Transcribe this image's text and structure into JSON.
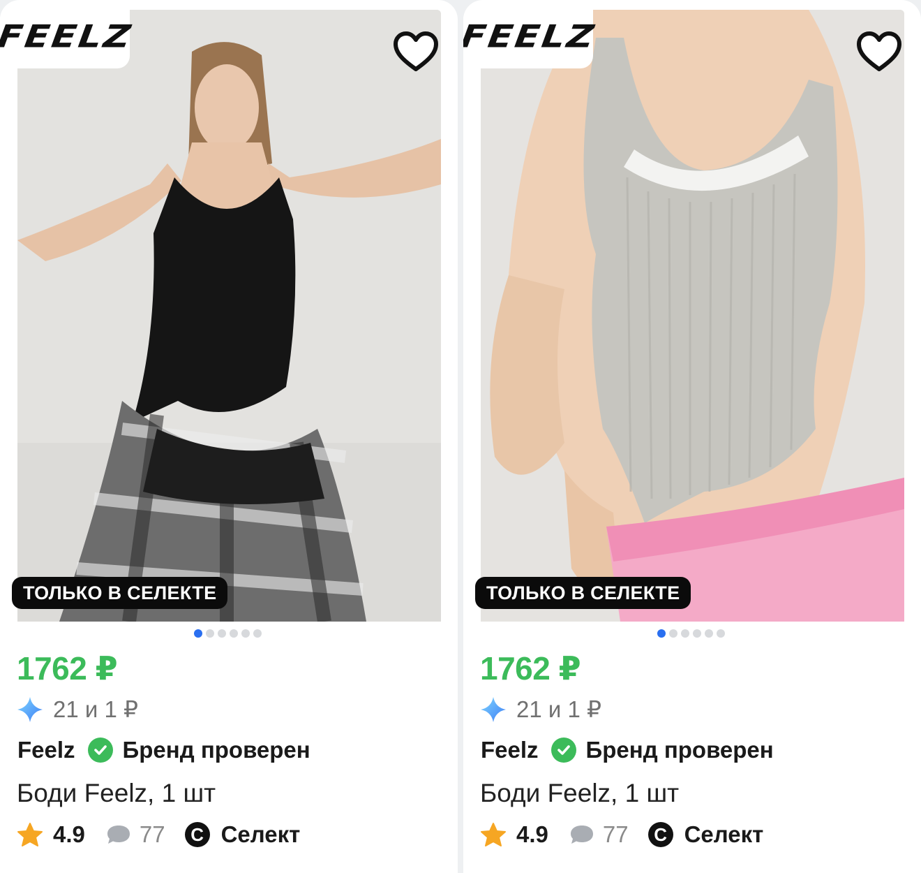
{
  "products": [
    {
      "brand_logo": "FEELZ",
      "favorite_icon": "heart-outline-icon",
      "badge": "ТОЛЬКО В СЕЛЕКТЕ",
      "image_count": 6,
      "active_image": 1,
      "price": "1762 ₽",
      "bonus_icon": "sparkle-icon",
      "bonus": "21 и 1 ₽",
      "brand": "Feelz",
      "verified_label": "Бренд проверен",
      "title": "Боди Feelz, 1 шт",
      "rating": "4.9",
      "reviews": "77",
      "select_mark": "C",
      "select_label": "Селект",
      "colors": {
        "price": "#3cbb5a",
        "verified": "#3cbb5a",
        "active_dot": "#2a6ff0"
      }
    },
    {
      "brand_logo": "FEELZ",
      "favorite_icon": "heart-outline-icon",
      "badge": "ТОЛЬКО В СЕЛЕКТЕ",
      "image_count": 6,
      "active_image": 1,
      "price": "1762 ₽",
      "bonus_icon": "sparkle-icon",
      "bonus": "21 и 1 ₽",
      "brand": "Feelz",
      "verified_label": "Бренд проверен",
      "title": "Боди Feelz, 1 шт",
      "rating": "4.9",
      "reviews": "77",
      "select_mark": "C",
      "select_label": "Селект",
      "colors": {
        "price": "#3cbb5a",
        "verified": "#3cbb5a",
        "active_dot": "#2a6ff0"
      }
    }
  ]
}
